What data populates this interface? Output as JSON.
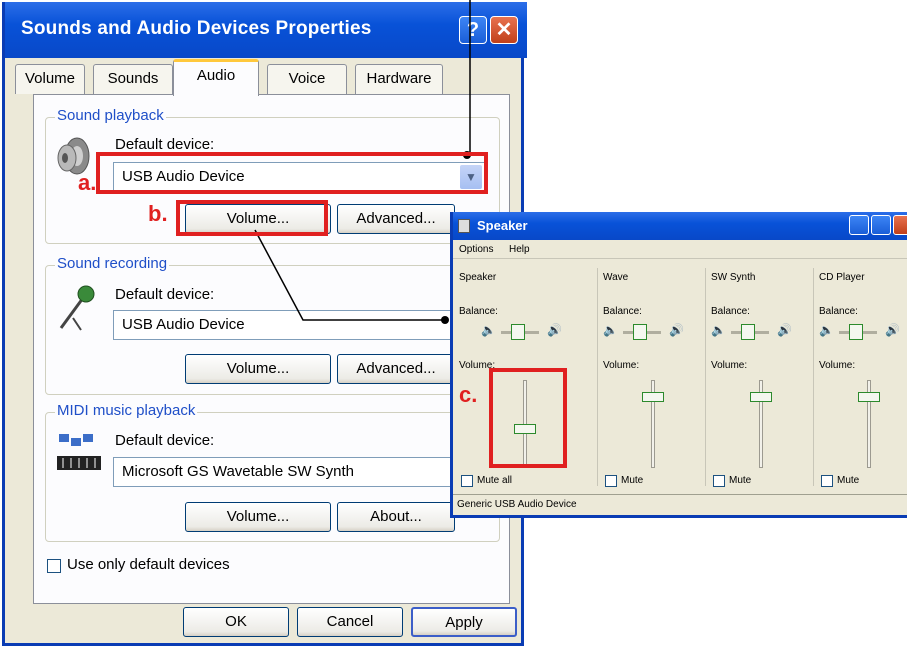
{
  "main_dialog": {
    "title": "Sounds and Audio Devices Properties",
    "help_label": "?",
    "close_label": "✕",
    "tabs": [
      "Volume",
      "Sounds",
      "Audio",
      "Voice",
      "Hardware"
    ],
    "active_tab": "Audio",
    "playback": {
      "group_label": "Sound playback",
      "default_label": "Default device:",
      "device": "USB Audio Device",
      "volume_label": "Volume...",
      "advanced_label": "Advanced..."
    },
    "recording": {
      "group_label": "Sound recording",
      "default_label": "Default device:",
      "device": "USB Audio Device",
      "volume_label": "Volume...",
      "advanced_label": "Advanced..."
    },
    "midi": {
      "group_label": "MIDI music playback",
      "default_label": "Default device:",
      "device": "Microsoft GS Wavetable SW Synth",
      "volume_label": "Volume...",
      "about_label": "About..."
    },
    "use_only_default": "Use only default devices",
    "ok_label": "OK",
    "cancel_label": "Cancel",
    "apply_label": "Apply"
  },
  "annotations": {
    "a": "a.",
    "b": "b.",
    "c": "c."
  },
  "speaker_window": {
    "title": "Speaker",
    "menu": [
      "Options",
      "Help"
    ],
    "balance_label": "Balance:",
    "volume_label": "Volume:",
    "channels": [
      {
        "name": "Speaker",
        "mute_label": "Mute all",
        "volume_level": 0.45
      },
      {
        "name": "Wave",
        "mute_label": "Mute",
        "volume_level": 0.85
      },
      {
        "name": "SW Synth",
        "mute_label": "Mute",
        "volume_level": 0.85
      },
      {
        "name": "CD Player",
        "mute_label": "Mute",
        "volume_level": 0.85
      }
    ],
    "status": "Generic USB Audio Device"
  },
  "colors": {
    "titlebar": "#0852d8",
    "annotation_red": "#e02020",
    "group_label_blue": "#1f4fc8"
  }
}
